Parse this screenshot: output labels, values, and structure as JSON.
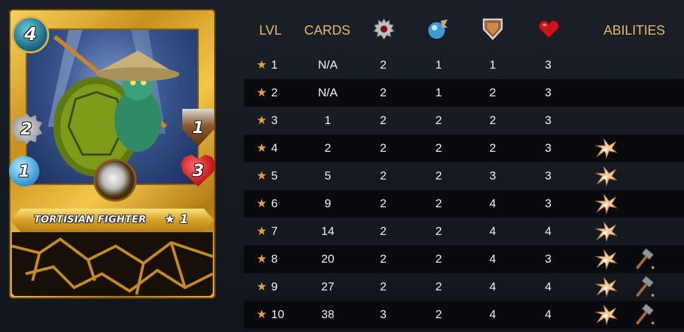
{
  "card": {
    "name": "TORTISIAN FIGHTER",
    "level_label": "★ 1",
    "mana": "4",
    "melee": "2",
    "speed": "1",
    "armor": "1",
    "health": "3"
  },
  "table": {
    "headers": {
      "lvl": "LVL",
      "cards": "CARDS",
      "abilities": "ABILITIES"
    },
    "header_icons": [
      "melee-attack-icon",
      "speed-icon",
      "armor-icon",
      "health-icon"
    ],
    "star_glyph": "★",
    "rows": [
      {
        "lvl": "1",
        "cards": "N/A",
        "attack": "2",
        "speed": "1",
        "armor": "1",
        "health": "3",
        "abilities": []
      },
      {
        "lvl": "2",
        "cards": "N/A",
        "attack": "2",
        "speed": "1",
        "armor": "2",
        "health": "3",
        "abilities": []
      },
      {
        "lvl": "3",
        "cards": "1",
        "attack": "2",
        "speed": "2",
        "armor": "2",
        "health": "3",
        "abilities": []
      },
      {
        "lvl": "4",
        "cards": "2",
        "attack": "2",
        "speed": "2",
        "armor": "2",
        "health": "3",
        "abilities": [
          "shatter-icon"
        ]
      },
      {
        "lvl": "5",
        "cards": "5",
        "attack": "2",
        "speed": "2",
        "armor": "3",
        "health": "3",
        "abilities": [
          "shatter-icon"
        ]
      },
      {
        "lvl": "6",
        "cards": "9",
        "attack": "2",
        "speed": "2",
        "armor": "4",
        "health": "3",
        "abilities": [
          "shatter-icon"
        ]
      },
      {
        "lvl": "7",
        "cards": "14",
        "attack": "2",
        "speed": "2",
        "armor": "4",
        "health": "4",
        "abilities": [
          "shatter-icon"
        ]
      },
      {
        "lvl": "8",
        "cards": "20",
        "attack": "2",
        "speed": "2",
        "armor": "4",
        "health": "3",
        "abilities": [
          "shatter-icon",
          "hammer-icon"
        ]
      },
      {
        "lvl": "9",
        "cards": "27",
        "attack": "2",
        "speed": "2",
        "armor": "4",
        "health": "4",
        "abilities": [
          "shatter-icon",
          "hammer-icon"
        ]
      },
      {
        "lvl": "10",
        "cards": "38",
        "attack": "3",
        "speed": "2",
        "armor": "4",
        "health": "4",
        "abilities": [
          "shatter-icon",
          "hammer-icon"
        ]
      }
    ]
  },
  "colors": {
    "header_text": "#e6b966",
    "star": "#e0a33a",
    "background": "#151a21",
    "row_shade": "#080a0d"
  }
}
